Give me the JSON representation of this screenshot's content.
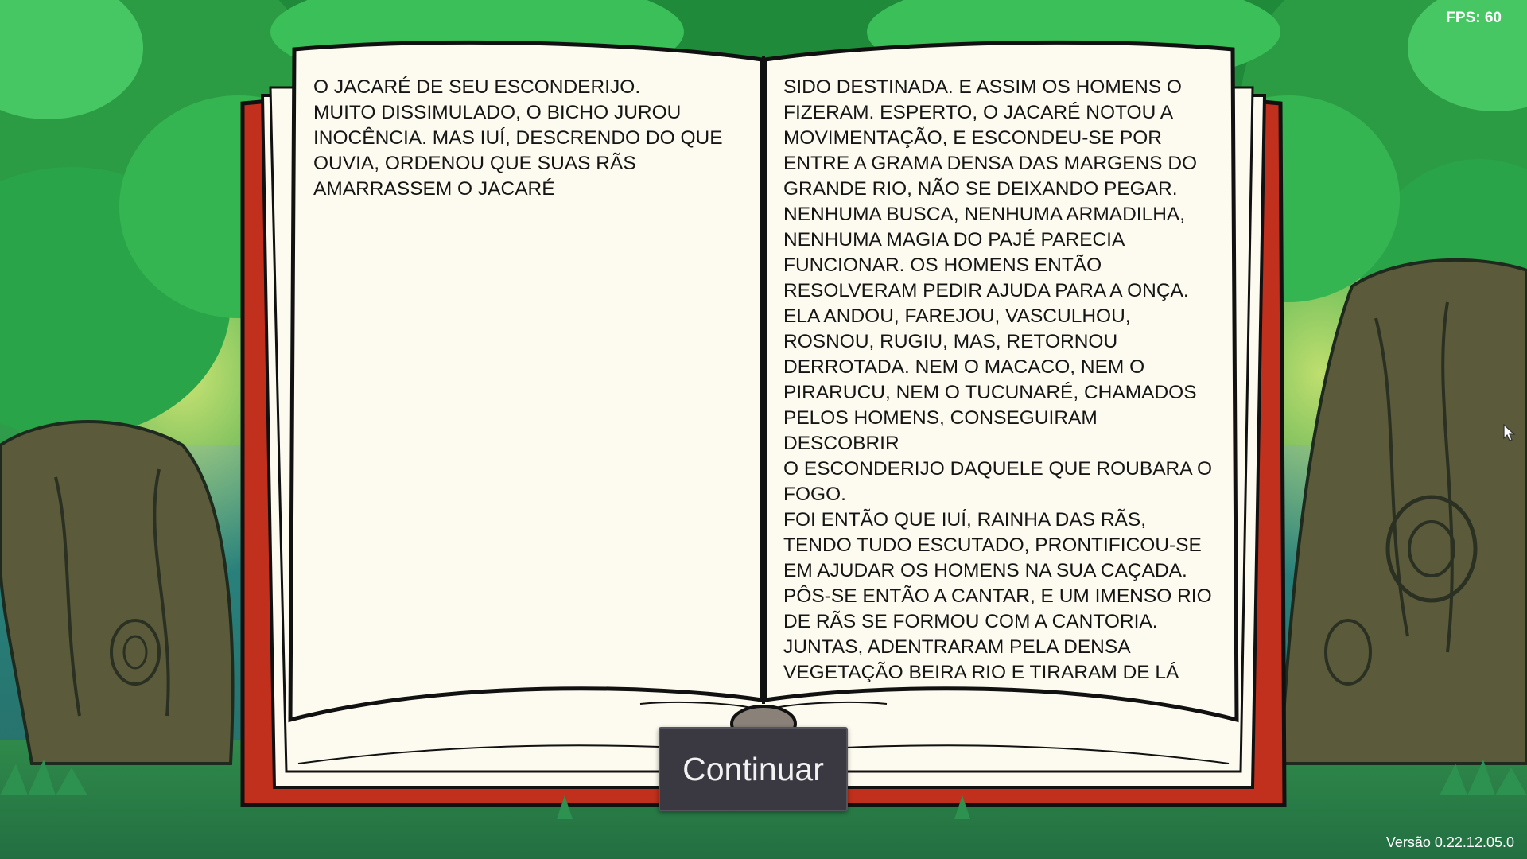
{
  "hud": {
    "fps_label": "FPS: 60",
    "version_label": "Versão 0.22.12.05.0"
  },
  "book": {
    "left_page": "O JACARÉ DE SEU ESCONDERIJO.\nMUITO DISSIMULADO, O BICHO JUROU\nINOCÊNCIA. MAS IUÍ, DESCRENDO DO QUE\nOUVIA, ORDENOU QUE SUAS RÃS\nAMARRASSEM O JACARÉ",
    "right_page": "SIDO DESTINADA. E ASSIM OS HOMENS O\nFIZERAM. ESPERTO, O JACARÉ NOTOU A\nMOVIMENTAÇÃO, E ESCONDEU-SE POR\nENTRE A GRAMA DENSA DAS MARGENS DO\nGRANDE RIO, NÃO SE DEIXANDO PEGAR.\nNENHUMA BUSCA, NENHUMA ARMADILHA,\nNENHUMA MAGIA DO PAJÉ PARECIA\nFUNCIONAR. OS HOMENS ENTÃO\nRESOLVERAM PEDIR AJUDA PARA A ONÇA.\nELA ANDOU, FAREJOU, VASCULHOU,\nROSNOU, RUGIU, MAS, RETORNOU\nDERROTADA. NEM O MACACO, NEM O\nPIRARUCU, NEM O TUCUNARÉ, CHAMADOS\nPELOS HOMENS, CONSEGUIRAM DESCOBRIR\nO ESCONDERIJO DAQUELE QUE ROUBARA O\nFOGO.\nFOI ENTÃO QUE IUÍ, RAINHA DAS RÃS,\nTENDO TUDO ESCUTADO, PRONTIFICOU-SE\nEM AJUDAR OS HOMENS NA SUA CAÇADA.\nPÔS-SE ENTÃO A CANTAR, E UM IMENSO RIO\nDE RÃS SE FORMOU COM A CANTORIA.\nJUNTAS, ADENTRARAM PELA DENSA\nVEGETAÇÃO BEIRA RIO E TIRARAM DE LÁ"
  },
  "controls": {
    "continue_label": "Continuar"
  },
  "colors": {
    "foliage": "#2fa24a",
    "trunk": "#5b5a3a",
    "book_cover": "#c0301c",
    "page": "#fdfbef",
    "button": "#3a3942"
  }
}
